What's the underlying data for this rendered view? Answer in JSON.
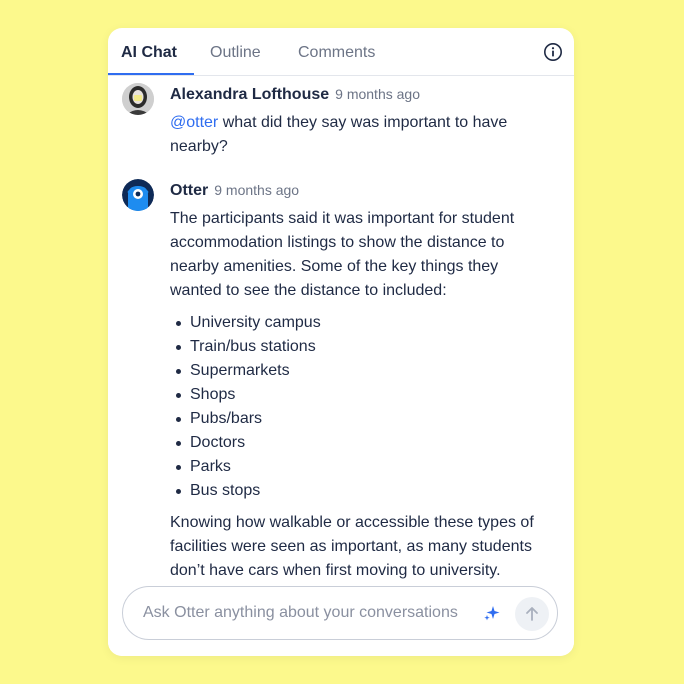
{
  "tabs": [
    {
      "label": "AI Chat",
      "active": true
    },
    {
      "label": "Outline",
      "active": false
    },
    {
      "label": "Comments",
      "active": false
    }
  ],
  "info_icon": "info-icon",
  "messages": [
    {
      "author": "Alexandra Lofthouse",
      "time": "9 months ago",
      "mention": "@otter",
      "text_line1": " what did they say was important to have",
      "text_line2": "nearby?"
    },
    {
      "author": "Otter",
      "time": "9 months ago",
      "intro_lines": [
        "The participants said it was important for student",
        "accommodation listings to show the distance to",
        "nearby amenities. Some of the key things they",
        "wanted to see the distance to included:"
      ],
      "bullets": [
        "University campus",
        "Train/bus stations",
        "Supermarkets",
        "Shops",
        "Pubs/bars",
        "Doctors",
        "Parks",
        "Bus stops"
      ],
      "outro_lines": [
        "Knowing how walkable or accessible these types of",
        "facilities were seen as important, as many students",
        "don’t have cars when first moving to university."
      ]
    }
  ],
  "input": {
    "placeholder": "Ask Otter anything about your conversations"
  },
  "colors": {
    "background": "#FCF98C",
    "accent": "#2F6DF0",
    "otter_blue": "#1E8CF0"
  }
}
